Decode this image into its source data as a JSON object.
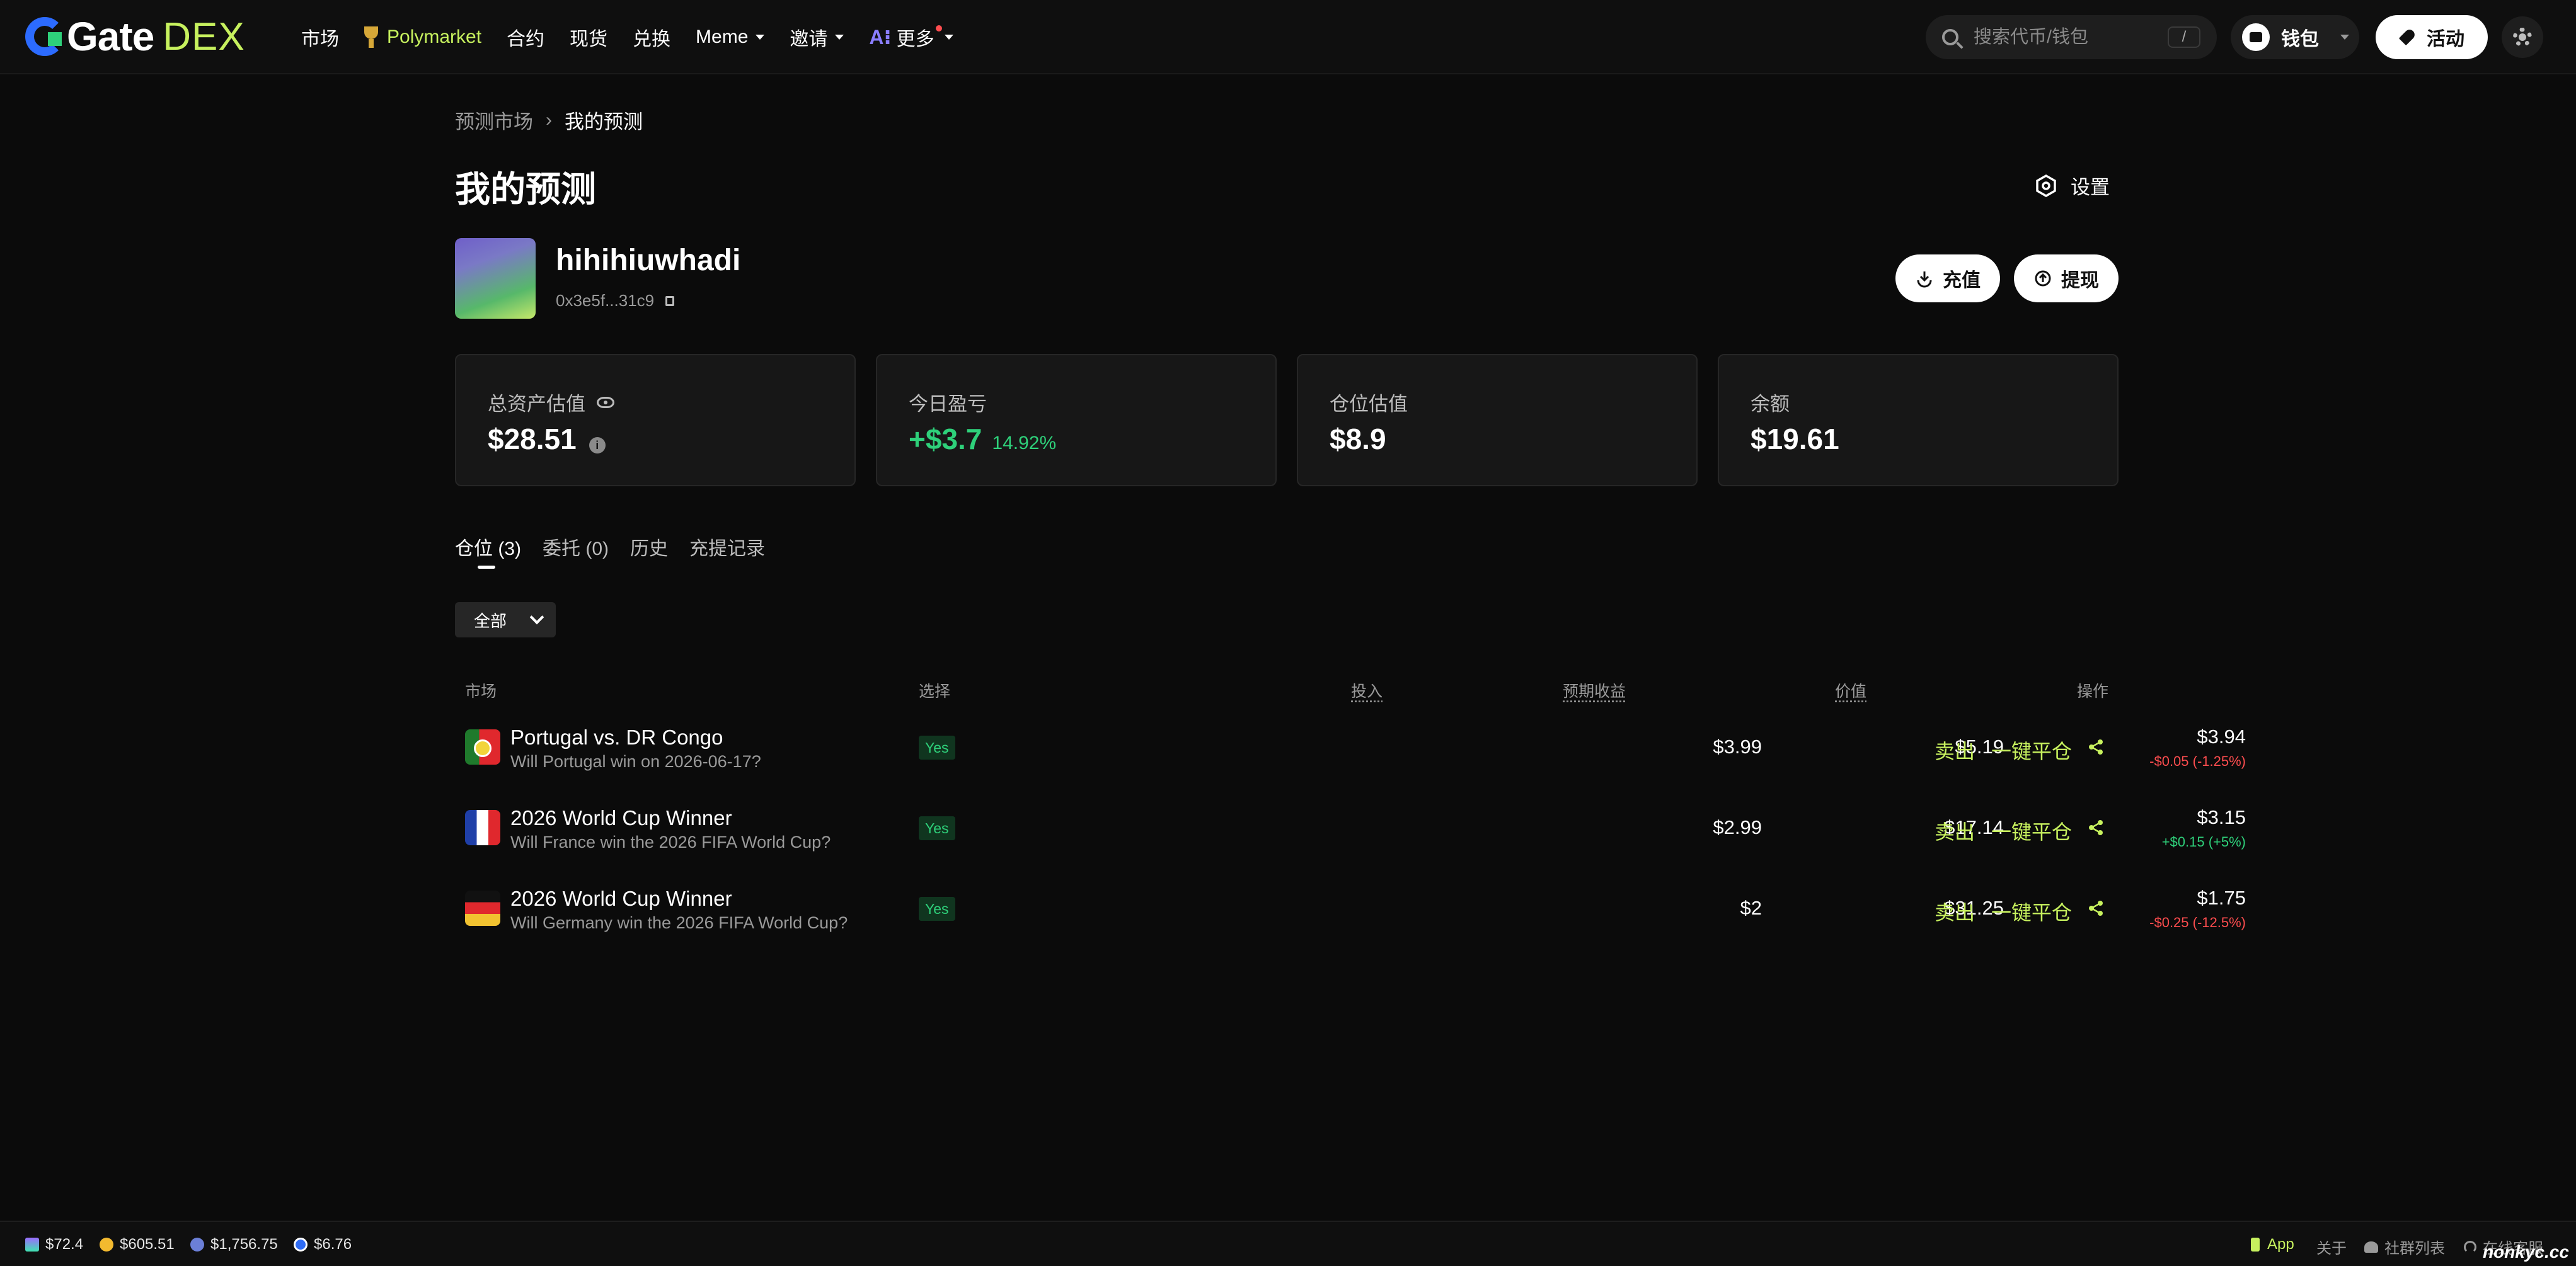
{
  "nav": {
    "logo_text": "Gate",
    "logo_dex": "DEX",
    "items": [
      {
        "label": "市场"
      },
      {
        "label": "Polymarket"
      },
      {
        "label": "合约"
      },
      {
        "label": "现货"
      },
      {
        "label": "兑换"
      },
      {
        "label": "Meme"
      },
      {
        "label": "邀请"
      },
      {
        "label": "更多"
      }
    ],
    "ai_badge": "A⁝",
    "search_placeholder": "搜索代币/钱包",
    "search_shortcut": "/",
    "wallet_label": "钱包",
    "activity_label": "活动"
  },
  "breadcrumb": {
    "parent": "预测市场",
    "separator": "›",
    "current": "我的预测"
  },
  "page": {
    "title": "我的预测",
    "settings_label": "设置"
  },
  "profile": {
    "username": "hihihiuwhadi",
    "address": "0x3e5f...31c9",
    "deposit_label": "充值",
    "withdraw_label": "提现"
  },
  "stats": [
    {
      "label": "总资产估值",
      "value": "$28.51"
    },
    {
      "label": "今日盈亏",
      "value": "+$3.7",
      "sub": "14.92%"
    },
    {
      "label": "仓位估值",
      "value": "$8.9"
    },
    {
      "label": "余额",
      "value": "$19.61"
    }
  ],
  "tabs": [
    {
      "label": "仓位 (3)"
    },
    {
      "label": "委托 (0)"
    },
    {
      "label": "历史"
    },
    {
      "label": "充提记录"
    }
  ],
  "filter": {
    "label": "全部"
  },
  "table": {
    "headers": {
      "market": "市场",
      "choice": "选择",
      "invested": "投入",
      "expected": "预期收益",
      "value": "价值",
      "action": "操作"
    },
    "rows": [
      {
        "title": "Portugal vs. DR Congo",
        "subtitle": "Will Portugal win on 2026-06-17?",
        "choice": "Yes",
        "invested": "$3.99",
        "expected": "$5.19",
        "value": "$3.94",
        "change": "-$0.05 (-1.25%)",
        "sell": "卖出",
        "close": "一键平仓"
      },
      {
        "title": "2026 World Cup Winner",
        "subtitle": "Will France win the 2026 FIFA World Cup?",
        "choice": "Yes",
        "invested": "$2.99",
        "expected": "$17.14",
        "value": "$3.15",
        "change": "+$0.15 (+5%)",
        "sell": "卖出",
        "close": "一键平仓"
      },
      {
        "title": "2026 World Cup Winner",
        "subtitle": "Will Germany win the 2026 FIFA World Cup?",
        "choice": "Yes",
        "invested": "$2",
        "expected": "$31.25",
        "value": "$1.75",
        "change": "-$0.25 (-12.5%)",
        "sell": "卖出",
        "close": "一键平仓"
      }
    ]
  },
  "bottom": {
    "tickers": [
      {
        "value": "$72.4"
      },
      {
        "value": "$605.51"
      },
      {
        "value": "$1,756.75"
      },
      {
        "value": "$6.76"
      }
    ],
    "app_label": "App",
    "about_label": "关于",
    "community_label": "社群列表",
    "support_label": "在线客服"
  },
  "watermark": "nonkyc.cc",
  "colors": {
    "accent_lime": "#c7f15e",
    "positive": "#2ed07a",
    "negative": "#ff4d4f",
    "background": "#0b0b0b"
  }
}
